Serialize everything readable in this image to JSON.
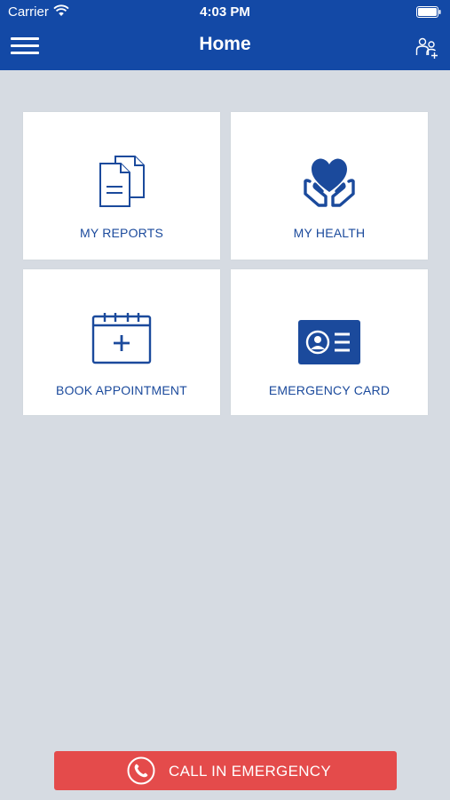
{
  "status_bar": {
    "carrier": "Carrier",
    "time": "4:03 PM"
  },
  "nav": {
    "title": "Home",
    "left_icon": "hamburger-menu-icon",
    "right_icon": "family-members-icon"
  },
  "tiles": [
    {
      "label": "MY REPORTS",
      "icon": "documents-icon"
    },
    {
      "label": "MY HEALTH",
      "icon": "heart-in-hands-icon"
    },
    {
      "label": "BOOK APPOINTMENT",
      "icon": "calendar-add-icon"
    },
    {
      "label": "EMERGENCY CARD",
      "icon": "id-card-icon"
    }
  ],
  "emergency_call": {
    "label": "CALL IN EMERGENCY",
    "icon": "phone-icon"
  },
  "colors": {
    "brand_blue": "#1349a6",
    "label_blue": "#1b4a9c",
    "background": "#d6dbe2",
    "emergency_red": "#e44b4b"
  }
}
